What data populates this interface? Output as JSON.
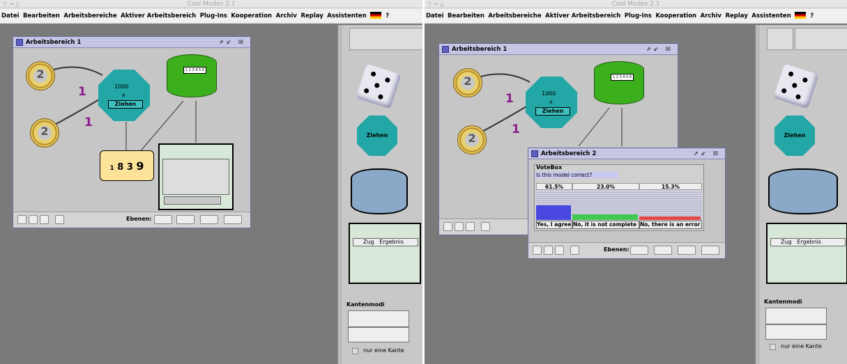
{
  "app_title": "Cool Modes 2.1",
  "menu": [
    "Datei",
    "Bearbeiten",
    "Arbeitsbereiche",
    "Aktiver Arbeitsbereich",
    "Plug-Ins",
    "Kooperation",
    "Archiv",
    "Replay",
    "Assistenten",
    "?"
  ],
  "workspace1": {
    "title": "Arbeitsbereich 1",
    "draw_count": "1000",
    "times": "x",
    "draw_button": "Ziehen",
    "edge_label_1": "1",
    "edge_label_2": "1",
    "ebenen_label": "Ebenen:",
    "urn_slots": "1 2 3 4 5 6",
    "reel_numbers": [
      "1",
      "8",
      "3",
      "9"
    ]
  },
  "workspace2": {
    "title": "Arbeitsbereich 2",
    "ebenen_label": "Ebenen:"
  },
  "votebox": {
    "title": "VoteBox",
    "question": "Is this model correct?",
    "percents": [
      "61.5%",
      "23.0%",
      "15.3%"
    ],
    "answers": [
      "Yes, I agree",
      "No, it is not complete",
      "No, there is an error"
    ],
    "bar_colors": [
      "#4848e0",
      "#40c850",
      "#e04848"
    ],
    "shares": [
      0.615,
      0.23,
      0.153
    ]
  },
  "palette": {
    "octagon_label": "Ziehen",
    "table_headers": [
      "Zug",
      "Ergebnis"
    ],
    "kantenmodi_label": "Kantenmodi",
    "single_edge_label": "nur eine Kante"
  }
}
